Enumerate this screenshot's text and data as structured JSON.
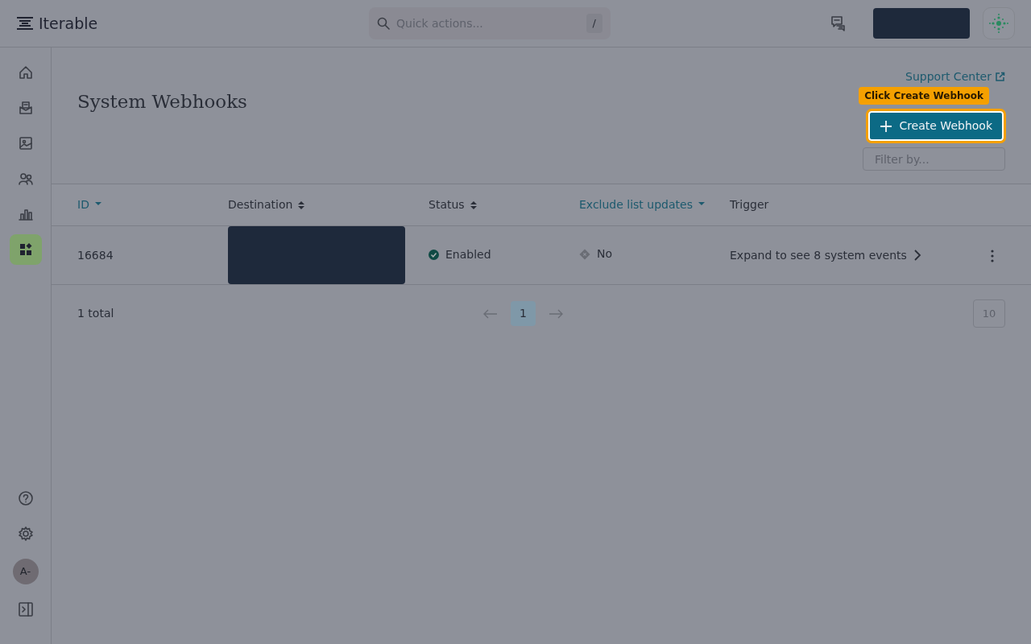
{
  "header": {
    "logo": "Iterable",
    "search": {
      "placeholder": "Quick actions...",
      "shortcut": "/"
    }
  },
  "sidebar": {
    "items": [
      {
        "kind": "home",
        "selected": false
      },
      {
        "kind": "inbox",
        "selected": false
      },
      {
        "kind": "image",
        "selected": false
      },
      {
        "kind": "users",
        "selected": false
      },
      {
        "kind": "chart",
        "selected": false
      },
      {
        "kind": "apps",
        "selected": true
      }
    ],
    "bottom": [
      {
        "kind": "help"
      },
      {
        "kind": "settings"
      },
      {
        "kind": "avatar",
        "label": "A-"
      },
      {
        "kind": "collapse"
      }
    ]
  },
  "page": {
    "title": "System Webhooks",
    "support_link": "Support Center",
    "tooltip": "Click Create Webhook",
    "create_button": "Create Webhook",
    "filter": {
      "placeholder": "Filter by..."
    }
  },
  "table": {
    "columns": [
      {
        "label": "ID",
        "sortable": true,
        "active": true
      },
      {
        "label": "Destination",
        "sortable": true,
        "active": false
      },
      {
        "label": "Status",
        "sortable": true,
        "active": false
      },
      {
        "label": "Exclude list updates",
        "sortable": true,
        "active": true
      },
      {
        "label": "Trigger",
        "sortable": false,
        "active": false
      }
    ],
    "rows": [
      {
        "id": "16684",
        "destination": {
          "redacted": true
        },
        "status": {
          "kind": "enabled",
          "label": "Enabled"
        },
        "exclude": {
          "kind": "no",
          "label": "No"
        },
        "trigger": "Expand to see 8 system events"
      }
    ]
  },
  "pagination": {
    "total": "1 total",
    "pages": [
      {
        "label": "1",
        "selected": true
      }
    ],
    "page_size": "10"
  }
}
